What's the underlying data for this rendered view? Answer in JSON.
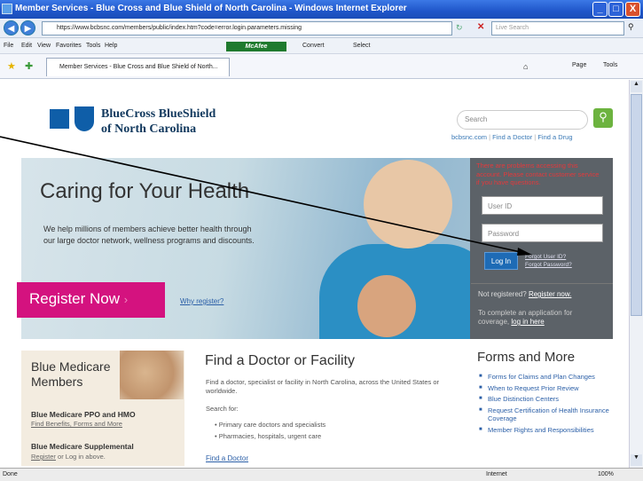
{
  "window": {
    "title": "Member Services - Blue Cross and Blue Shield of North Carolina - Windows Internet Explorer",
    "buttons": [
      "_",
      "□",
      "X"
    ]
  },
  "address": {
    "url": "https://www.bcbsnc.com/members/public/index.htm?code=error.login.parameters.missing",
    "search_placeholder": "Live Search"
  },
  "menu": {
    "items": [
      "File",
      "Edit",
      "View",
      "Favorites",
      "Tools",
      "Help"
    ],
    "mcafee": "McAfee",
    "convert": "Convert",
    "select": "Select"
  },
  "tabs": {
    "active": "Member Services - Blue Cross and Blue Shield of North...",
    "page_label": "Page",
    "tools_label": "Tools"
  },
  "header": {
    "brand_line1": "BlueCross BlueShield",
    "brand_line2": "of North Carolina",
    "search_placeholder": "Search",
    "links": [
      "bcbsnc.com",
      "Find a Doctor",
      "Find a Drug"
    ]
  },
  "hero": {
    "title": "Caring for Your Health",
    "text": "We help millions of members achieve better health through our large doctor network, wellness programs and discounts.",
    "register_label": "Register Now",
    "why_register": "Why register?"
  },
  "login": {
    "error": "There are problems accessing this account. Please contact customer service if you have questions.",
    "userid_placeholder": "User ID",
    "password_placeholder": "Password",
    "login_label": "Log In",
    "forgot_user": "Forgot User ID?",
    "forgot_password": "Forgot Password?",
    "not_registered": "Not registered?",
    "register_now": "Register now.",
    "complete_text": "To complete an application for coverage,",
    "log_in_here": "log in here"
  },
  "medicare": {
    "title_line1": "Blue Medicare",
    "title_line2": "Members",
    "ppo_title": "Blue Medicare PPO and HMO",
    "ppo_link": "Find Benefits, Forms and More",
    "supp_title": "Blue Medicare Supplemental",
    "supp_register": "Register",
    "supp_rest": "or Log in above."
  },
  "find_doctor": {
    "title": "Find a Doctor or Facility",
    "text": "Find a doctor, specialist or facility in North Carolina, across the United States or worldwide.",
    "search_for": "Search for:",
    "items": [
      "Primary care doctors and specialists",
      "Pharmacies, hospitals, urgent care"
    ],
    "link": "Find a Doctor"
  },
  "forms": {
    "title": "Forms and More",
    "items": [
      "Forms for Claims and Plan Changes",
      "When to Request Prior Review",
      "Blue Distinction Centers",
      "Request Certification of Health Insurance Coverage",
      "Member Rights and Responsibilities"
    ]
  },
  "status": {
    "left": "Done",
    "zone": "Internet",
    "zoom": "100%"
  }
}
